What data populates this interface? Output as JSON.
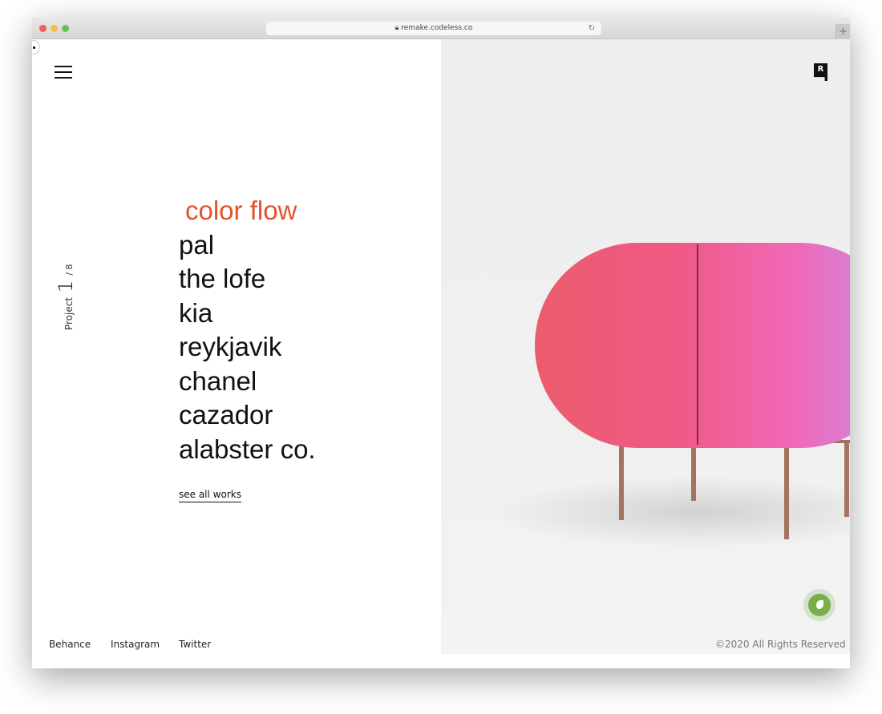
{
  "browser": {
    "url": "remake.codeless.co",
    "colors": {
      "close": "#ee5f57",
      "minimize": "#f4bd4f",
      "maximize": "#5fc453"
    }
  },
  "header": {
    "menu_icon": "hamburger-icon",
    "logo_text": "R"
  },
  "counter": {
    "label": "Project",
    "current": "1",
    "total": "/ 8"
  },
  "projects": {
    "items": [
      "color flow",
      "pal",
      "the lofe",
      "kia",
      "reykjavik",
      "chanel",
      "cazador",
      "alabster co."
    ],
    "active_index": 0,
    "active_color": "#e2532a",
    "highlight_color": "#6ff3ea"
  },
  "see_all": "see all works",
  "footer": {
    "links": [
      "Behance",
      "Instagram",
      "Twitter"
    ],
    "copyright": "©2020 All Rights Reserved"
  },
  "fab": {
    "icon": "envato-leaf-icon",
    "color": "#79ae48"
  }
}
